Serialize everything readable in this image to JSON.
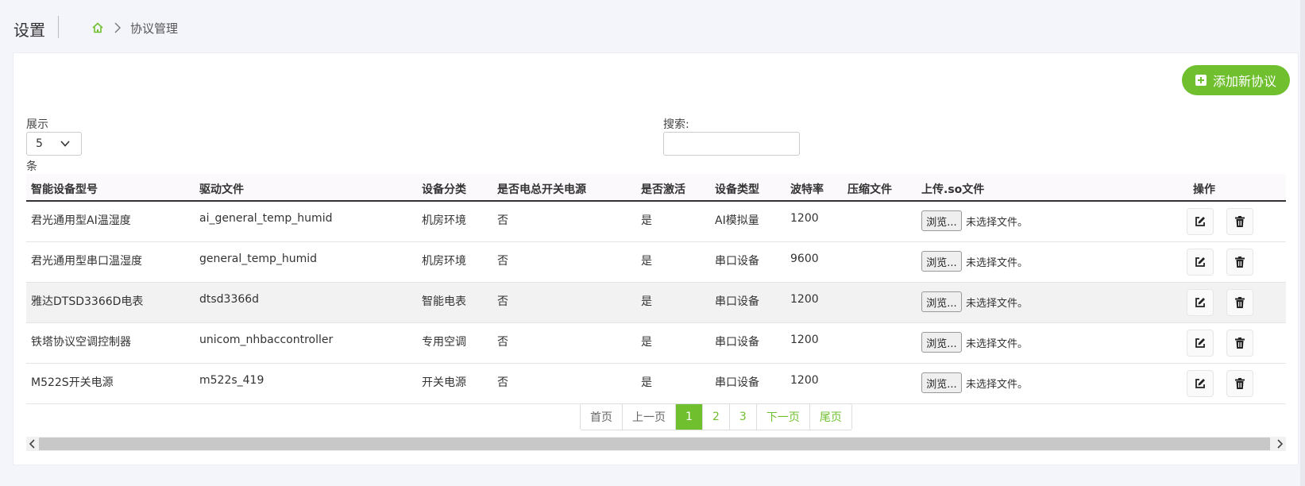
{
  "header": {
    "title": "设置",
    "breadcrumb_current": "协议管理"
  },
  "toolbar": {
    "add_label": "添加新协议"
  },
  "controls": {
    "show_label": "展示",
    "page_length": "5",
    "entries_label": "条",
    "search_label": "搜索:",
    "search_value": ""
  },
  "table": {
    "headers": [
      "智能设备型号",
      "驱动文件",
      "设备分类",
      "是否电总开关电源",
      "是否激活",
      "设备类型",
      "波特率",
      "压缩文件",
      "上传.so文件",
      "操作"
    ],
    "rows": [
      {
        "model": "君光通用型AI温湿度",
        "driver": "ai_general_temp_humid",
        "category": "机房环境",
        "power": "否",
        "active": "是",
        "type": "AI模拟量",
        "baud": "1200",
        "compressed": "",
        "browse": "浏览...",
        "nofile": "未选择文件。"
      },
      {
        "model": "君光通用型串口温湿度",
        "driver": "general_temp_humid",
        "category": "机房环境",
        "power": "否",
        "active": "是",
        "type": "串口设备",
        "baud": "9600",
        "compressed": "",
        "browse": "浏览...",
        "nofile": "未选择文件。"
      },
      {
        "model": "雅达DTSD3366D电表",
        "driver": "dtsd3366d",
        "category": "智能电表",
        "power": "否",
        "active": "是",
        "type": "串口设备",
        "baud": "1200",
        "compressed": "",
        "browse": "浏览...",
        "nofile": "未选择文件。"
      },
      {
        "model": "铁塔协议空调控制器",
        "driver": "unicom_nhbaccontroller",
        "category": "专用空调",
        "power": "否",
        "active": "是",
        "type": "串口设备",
        "baud": "1200",
        "compressed": "",
        "browse": "浏览...",
        "nofile": "未选择文件。"
      },
      {
        "model": "M522S开关电源",
        "driver": "m522s_419",
        "category": "开关电源",
        "power": "否",
        "active": "是",
        "type": "串口设备",
        "baud": "1200",
        "compressed": "",
        "browse": "浏览...",
        "nofile": "未选择文件。"
      }
    ]
  },
  "pagination": {
    "first": "首页",
    "prev": "上一页",
    "pages": [
      "1",
      "2",
      "3"
    ],
    "current": "1",
    "next": "下一页",
    "last": "尾页"
  },
  "colors": {
    "accent": "#6fbf2e",
    "header_rule": "#333333",
    "row_alt": "#f2f2f2"
  },
  "icons": [
    "home-icon",
    "chevron-right-icon",
    "plus-square-icon",
    "chevron-down-icon",
    "edit-icon",
    "trash-icon",
    "scroll-left-icon",
    "scroll-right-icon"
  ]
}
